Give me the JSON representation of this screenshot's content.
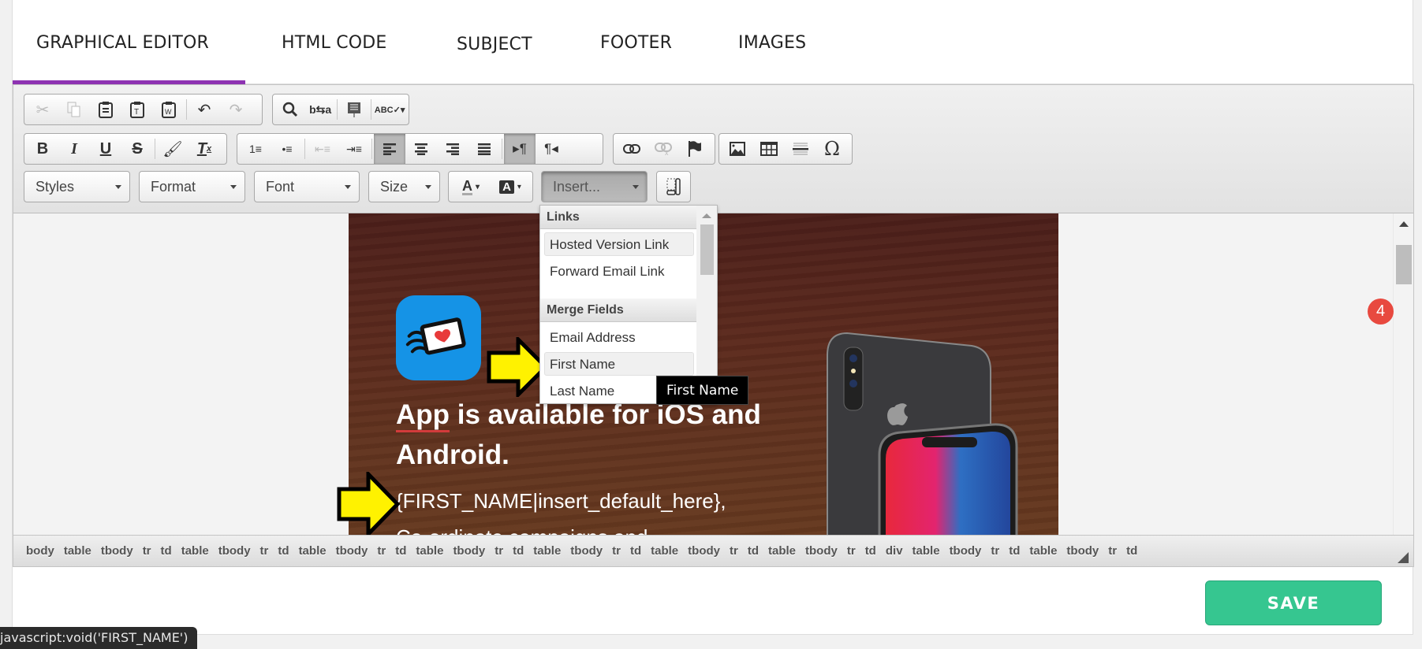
{
  "tabs": [
    {
      "label": "GRAPHICAL EDITOR",
      "active": true
    },
    {
      "label": "HTML CODE",
      "active": false
    },
    {
      "label": "SUBJECT",
      "active": false
    },
    {
      "label": "FOOTER",
      "active": false
    },
    {
      "label": "IMAGES",
      "active": false
    }
  ],
  "accent_color": "#8e33b2",
  "toolbar": {
    "row1": [
      "cut-icon",
      "copy-icon",
      "paste-icon",
      "paste-text-icon",
      "paste-word-icon",
      "undo-icon",
      "redo-icon",
      "find-icon",
      "replace-icon",
      "select-all-icon",
      "spellcheck-icon"
    ],
    "row2": [
      "bold-icon",
      "italic-icon",
      "underline-icon",
      "strike-icon",
      "copy-format-icon",
      "remove-format-icon",
      "numbered-list-icon",
      "bulleted-list-icon",
      "outdent-icon",
      "indent-icon",
      "align-left-icon",
      "align-center-icon",
      "align-right-icon",
      "justify-icon",
      "ltr-icon",
      "rtl-icon",
      "link-icon",
      "unlink-icon",
      "anchor-icon",
      "image-icon",
      "table-icon",
      "horizontal-rule-icon",
      "special-char-icon"
    ],
    "combos": {
      "styles": "Styles",
      "format": "Format",
      "font": "Font",
      "size": "Size",
      "insert": "Insert..."
    }
  },
  "insert_menu": {
    "sections": [
      {
        "heading": "Links",
        "items": [
          "Hosted Version Link",
          "Forward Email Link"
        ]
      },
      {
        "heading": "Merge Fields",
        "items": [
          "Email Address",
          "First Name",
          "Last Name"
        ]
      }
    ],
    "highlighted": [
      "Hosted Version Link",
      "First Name"
    ],
    "tooltip": "First Name"
  },
  "email": {
    "headline_word1": "App",
    "headline_rest": " is available for iOS and Android.",
    "merge_line": "{FIRST_NAME|insert_default_here},",
    "cut_line": "Co-ordinate campaigns and"
  },
  "notification_badge": "4",
  "path": [
    "body",
    "table",
    "tbody",
    "tr",
    "td",
    "table",
    "tbody",
    "tr",
    "td",
    "table",
    "tbody",
    "tr",
    "td",
    "table",
    "tbody",
    "tr",
    "td",
    "table",
    "tbody",
    "tr",
    "td",
    "table",
    "tbody",
    "tr",
    "td",
    "table",
    "tbody",
    "tr",
    "td",
    "div",
    "table",
    "tbody",
    "tr",
    "td",
    "table",
    "tbody",
    "tr",
    "td"
  ],
  "save_label": "SAVE",
  "status_url": "javascript:void('FIRST_NAME')"
}
